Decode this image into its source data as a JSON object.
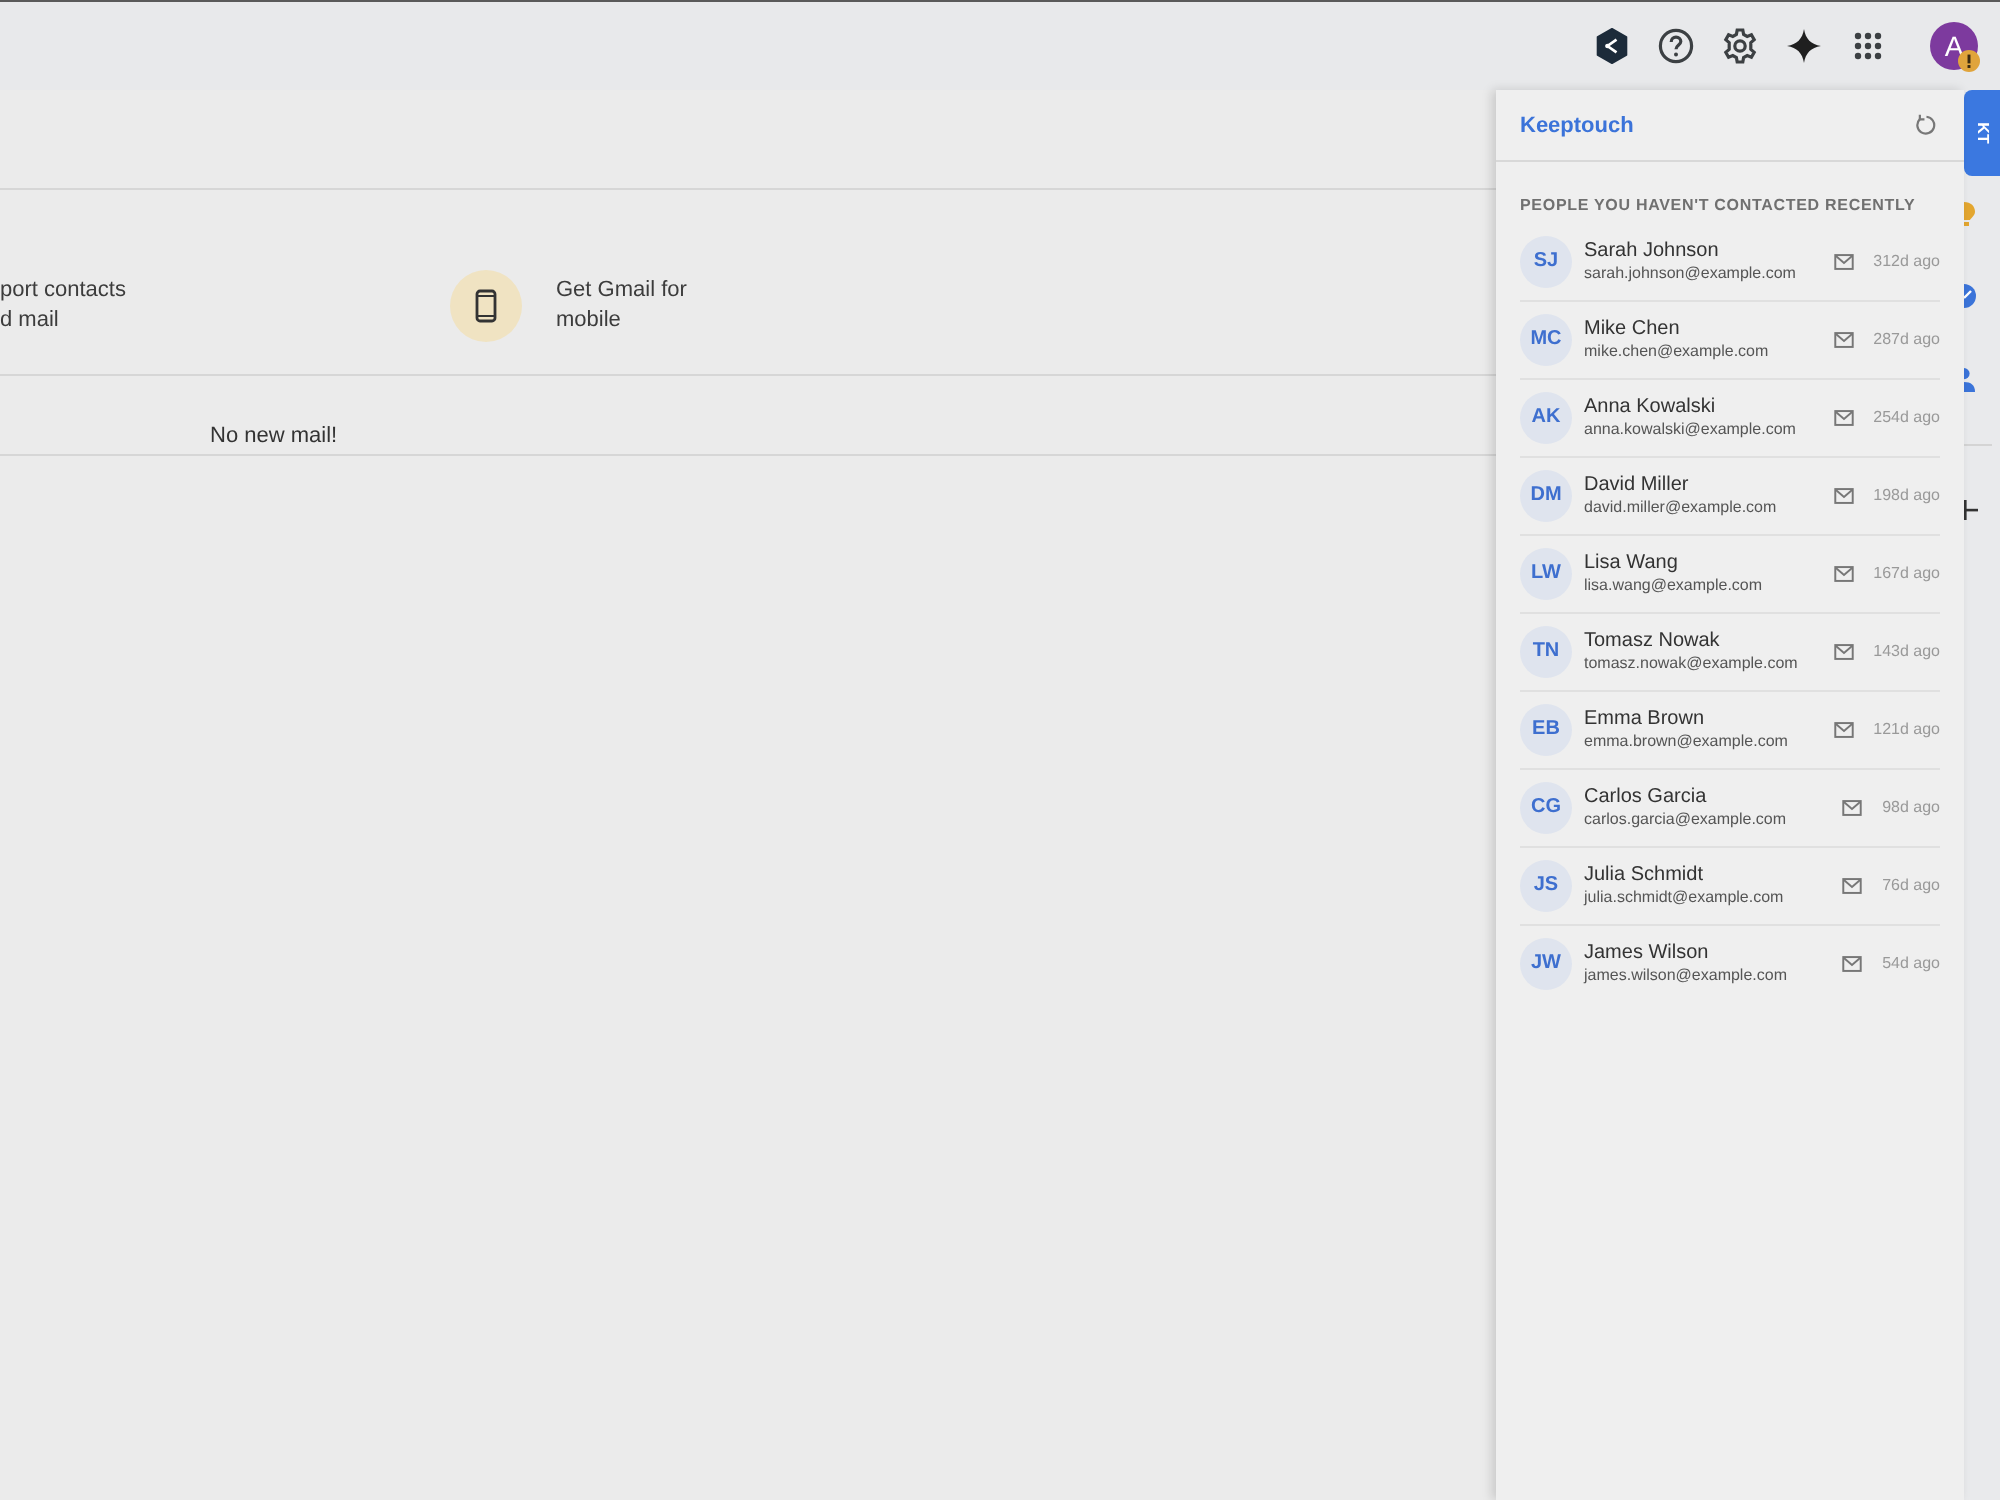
{
  "topbar": {
    "avatar": {
      "initial": "A",
      "warning": true
    }
  },
  "promos": [
    {
      "kind": "plain",
      "lines": [
        "port contacts",
        "d mail"
      ]
    },
    {
      "kind": "phone",
      "lines": [
        "Get Gmail for",
        "mobile"
      ]
    }
  ],
  "inbox": {
    "message": "No new mail!"
  },
  "panel": {
    "title": "Keeptouch",
    "section_title": "PEOPLE YOU HAVEN'T CONTACTED RECENTLY",
    "contacts": [
      {
        "initials": "SJ",
        "name": "Sarah Johnson",
        "email": "sarah.johnson@example.com",
        "last_contact": "312d ago"
      },
      {
        "initials": "MC",
        "name": "Mike Chen",
        "email": "mike.chen@example.com",
        "last_contact": "287d ago"
      },
      {
        "initials": "AK",
        "name": "Anna Kowalski",
        "email": "anna.kowalski@example.com",
        "last_contact": "254d ago"
      },
      {
        "initials": "DM",
        "name": "David Miller",
        "email": "david.miller@example.com",
        "last_contact": "198d ago"
      },
      {
        "initials": "LW",
        "name": "Lisa Wang",
        "email": "lisa.wang@example.com",
        "last_contact": "167d ago"
      },
      {
        "initials": "TN",
        "name": "Tomasz Nowak",
        "email": "tomasz.nowak@example.com",
        "last_contact": "143d ago"
      },
      {
        "initials": "EB",
        "name": "Emma Brown",
        "email": "emma.brown@example.com",
        "last_contact": "121d ago"
      },
      {
        "initials": "CG",
        "name": "Carlos Garcia",
        "email": "carlos.garcia@example.com",
        "last_contact": "98d ago"
      },
      {
        "initials": "JS",
        "name": "Julia Schmidt",
        "email": "julia.schmidt@example.com",
        "last_contact": "76d ago"
      },
      {
        "initials": "JW",
        "name": "James Wilson",
        "email": "james.wilson@example.com",
        "last_contact": "54d ago"
      }
    ]
  },
  "side_tab": {
    "label": "KT"
  }
}
